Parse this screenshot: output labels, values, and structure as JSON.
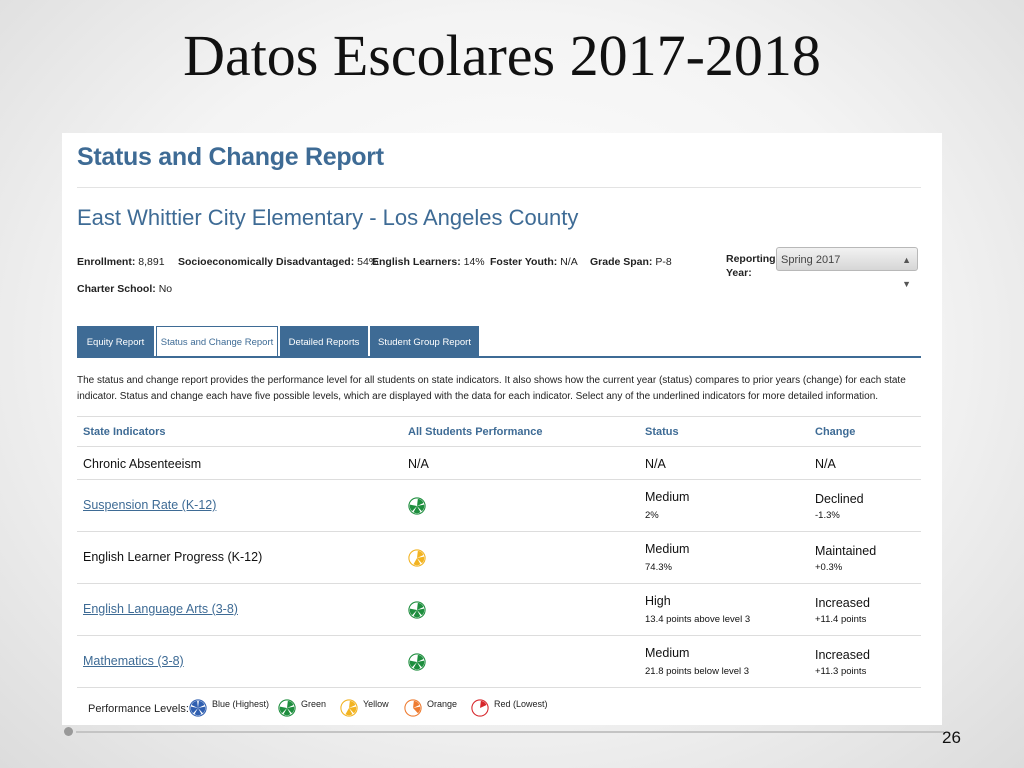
{
  "slide": {
    "title": "Datos Escolares 2017-2018",
    "page_number": "26"
  },
  "report": {
    "title": "Status and Change Report",
    "school": "East Whittier City Elementary - Los Angeles County",
    "meta": [
      {
        "label": "Enrollment:",
        "value": "8,891"
      },
      {
        "label": "Socioeconomically Disadvantaged:",
        "value": "54%"
      },
      {
        "label": "English Learners:",
        "value": "14%"
      },
      {
        "label": "Foster Youth:",
        "value": "N/A"
      },
      {
        "label": "Grade Span:",
        "value": "P-8"
      },
      {
        "label": "Charter School:",
        "value": "No"
      }
    ],
    "reporting_year": {
      "label": "Reporting Year:",
      "value": "Spring 2017"
    },
    "tabs": [
      "Equity Report",
      "Status and Change Report",
      "Detailed Reports",
      "Student Group Report"
    ],
    "active_tab": 1,
    "description": "The status and change report provides the performance level for all students on state indicators. It also shows how the current year (status) compares to prior years (change) for each state indicator. Status and change each have five possible levels, which are displayed with the data for each indicator. Select any of the underlined indicators for more detailed information.",
    "columns": [
      "State Indicators",
      "All Students Performance",
      "Status",
      "Change"
    ],
    "rows": [
      {
        "indicator": "Chronic Absenteeism",
        "link": false,
        "performance": "N/A",
        "level": "",
        "status": "N/A",
        "status_detail": "",
        "change": "N/A",
        "change_detail": ""
      },
      {
        "indicator": "Suspension Rate (K-12)",
        "link": true,
        "performance": "",
        "level": "green",
        "status": "Medium",
        "status_detail": "2%",
        "change": "Declined",
        "change_detail": "-1.3%"
      },
      {
        "indicator": "English Learner Progress (K-12)",
        "link": false,
        "performance": "",
        "level": "yellow",
        "status": "Medium",
        "status_detail": "74.3%",
        "change": "Maintained",
        "change_detail": "+0.3%"
      },
      {
        "indicator": "English Language Arts (3-8)",
        "link": true,
        "performance": "",
        "level": "green",
        "status": "High",
        "status_detail": "13.4 points above level 3",
        "change": "Increased",
        "change_detail": "+11.4 points"
      },
      {
        "indicator": "Mathematics (3-8)",
        "link": true,
        "performance": "",
        "level": "green",
        "status": "Medium",
        "status_detail": "21.8 points below level 3",
        "change": "Increased",
        "change_detail": "+11.3 points"
      }
    ],
    "legend": {
      "label": "Performance Levels:",
      "items": [
        {
          "name": "Blue (Highest)",
          "level": "blue"
        },
        {
          "name": "Green",
          "level": "green"
        },
        {
          "name": "Yellow",
          "level": "yellow"
        },
        {
          "name": "Orange",
          "level": "orange"
        },
        {
          "name": "Red (Lowest)",
          "level": "red"
        }
      ]
    }
  },
  "colors": {
    "accent": "#3e6b95",
    "blue": "#2f5fb0",
    "green": "#1e8e3e",
    "yellow": "#f2b320",
    "orange": "#ee7b30",
    "red": "#d7262b"
  }
}
